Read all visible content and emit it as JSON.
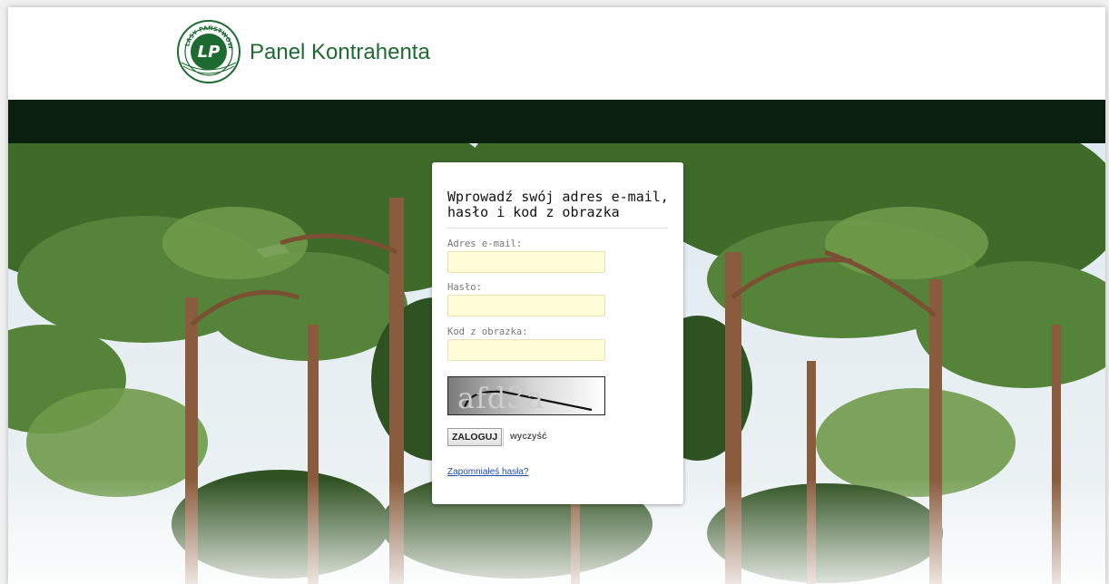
{
  "header": {
    "title": "Panel Kontrahenta",
    "logo_text": "LASY PAŃSTWOWE",
    "logo_mark": "LP"
  },
  "login": {
    "heading": "Wprowadź swój adres e-mail, hasło i kod z obrazka",
    "email_label": "Adres e-mail:",
    "email_value": "",
    "password_label": "Hasło:",
    "password_value": "",
    "captcha_label": "Kod z obrazka:",
    "captcha_value": "",
    "captcha_text": "afd3a",
    "login_button": "ZALOGUJ",
    "clear_button": "wyczyść",
    "forgot_link": "Zapomniałeś hasła?"
  },
  "colors": {
    "brand_green": "#1d6b30",
    "topbar": "#0b1f0e",
    "input_bg": "#fffcd7",
    "link": "#1f4fa8"
  }
}
